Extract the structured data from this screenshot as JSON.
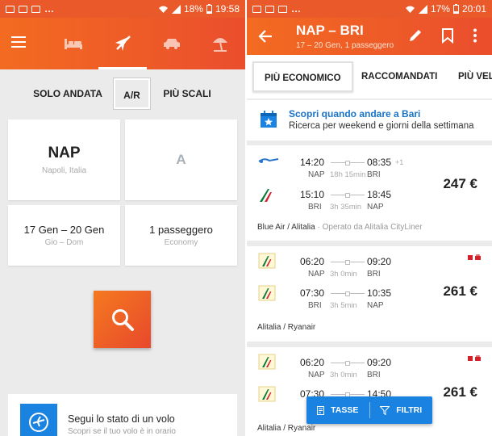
{
  "left": {
    "status": {
      "battery": "18%",
      "time": "19:58"
    },
    "tabs": [
      "hotel-icon",
      "flight-icon",
      "car-icon",
      "beach-umbrella-icon"
    ],
    "trip_types": [
      {
        "label": "SOLO ANDATA"
      },
      {
        "label": "A/R",
        "active": true
      },
      {
        "label": "PIÙ SCALI"
      }
    ],
    "origin": {
      "code": "NAP",
      "name": "Napoli, Italia"
    },
    "destination": {
      "placeholder": "A"
    },
    "dates": {
      "value": "17 Gen – 20 Gen",
      "days": "Gio – Dom"
    },
    "passengers": {
      "value": "1 passeggero",
      "class": "Economy"
    },
    "flight_status": {
      "title": "Segui lo stato di un volo",
      "subtitle": "Scopri se il tuo volo è in orario"
    }
  },
  "right": {
    "status": {
      "battery": "17%",
      "time": "20:01"
    },
    "header": {
      "route": "NAP – BRI",
      "details": "17 – 20 Gen, 1 passeggero"
    },
    "sort_tabs": [
      "PIÙ ECONOMICO",
      "RACCOMANDATI",
      "PIÙ VELOCI"
    ],
    "promo": {
      "title": "Scopri quando andare a Bari",
      "subtitle": "Ricerca per weekend e giorni della settimana"
    },
    "results": [
      {
        "price": "247 €",
        "airline": "Blue Air / Alitalia",
        "operated": "· Operato da Alitalia CityLiner",
        "legs": [
          {
            "dep": "14:20",
            "arr": "08:35",
            "plus": "+1",
            "from": "NAP",
            "to": "BRI",
            "duration": "18h 15min"
          },
          {
            "dep": "15:10",
            "arr": "18:45",
            "plus": "",
            "from": "BRI",
            "to": "NAP",
            "duration": "3h 35min"
          }
        ]
      },
      {
        "price": "261 €",
        "airline": "Alitalia / Ryanair",
        "operated": "",
        "legs": [
          {
            "dep": "06:20",
            "arr": "09:20",
            "plus": "",
            "from": "NAP",
            "to": "BRI",
            "duration": "3h 0min"
          },
          {
            "dep": "07:30",
            "arr": "10:35",
            "plus": "",
            "from": "BRI",
            "to": "NAP",
            "duration": "3h 5min"
          }
        ]
      },
      {
        "price": "261 €",
        "airline": "Alitalia / Ryanair",
        "operated": "",
        "legs": [
          {
            "dep": "06:20",
            "arr": "09:20",
            "plus": "",
            "from": "NAP",
            "to": "BRI",
            "duration": "3h 0min"
          },
          {
            "dep": "07:30",
            "arr": "14:50",
            "plus": "",
            "from": "BRI",
            "to": "NAP",
            "duration": ""
          }
        ]
      }
    ],
    "fab": {
      "taxes": "TASSE",
      "filters": "FILTRI"
    }
  },
  "colors": {
    "accent": "#f36b21",
    "accent_dark": "#ea4e2d",
    "blue": "#1a82e0",
    "background": "#ebebeb"
  }
}
